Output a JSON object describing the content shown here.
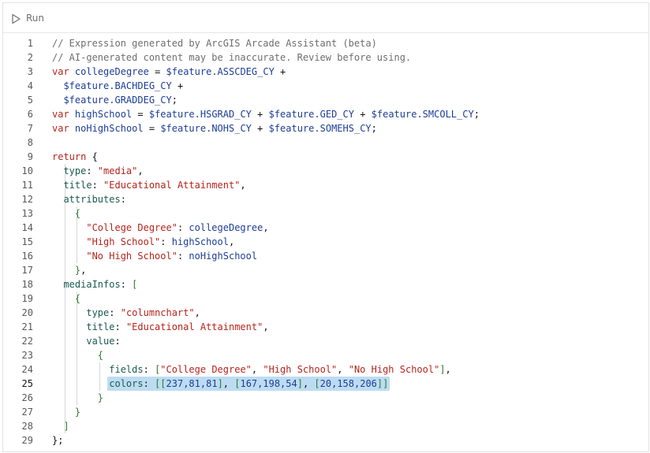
{
  "toolbar": {
    "run_label": "Run",
    "run_icon": "play-icon"
  },
  "editor": {
    "active_line": 25,
    "colors": {
      "comment": "#6e6e6e",
      "keyword": "#b6241c",
      "string": "#b6241c",
      "variable": "#1d3d97",
      "property": "#1a5b4d",
      "selection": "#bddcf2"
    },
    "lines": [
      {
        "n": "1",
        "tokens": [
          [
            "c",
            "// Expression generated by ArcGIS Arcade Assistant (beta)"
          ]
        ]
      },
      {
        "n": "2",
        "tokens": [
          [
            "c",
            "// AI-generated content may be inaccurate. Review before using."
          ]
        ]
      },
      {
        "n": "3",
        "tokens": [
          [
            "k",
            "var"
          ],
          [
            "p",
            " "
          ],
          [
            "v",
            "collegeDegree"
          ],
          [
            "p",
            " = "
          ],
          [
            "v",
            "$feature.ASSCDEG_CY"
          ],
          [
            "p",
            " +"
          ]
        ]
      },
      {
        "n": "4",
        "tokens": [
          [
            "p",
            "  "
          ],
          [
            "v",
            "$feature.BACHDEG_CY"
          ],
          [
            "p",
            " +"
          ]
        ]
      },
      {
        "n": "5",
        "tokens": [
          [
            "p",
            "  "
          ],
          [
            "v",
            "$feature.GRADDEG_CY"
          ],
          [
            "p",
            ";"
          ]
        ]
      },
      {
        "n": "6",
        "tokens": [
          [
            "k",
            "var"
          ],
          [
            "p",
            " "
          ],
          [
            "v",
            "highSchool"
          ],
          [
            "p",
            " = "
          ],
          [
            "v",
            "$feature.HSGRAD_CY"
          ],
          [
            "p",
            " + "
          ],
          [
            "v",
            "$feature.GED_CY"
          ],
          [
            "p",
            " + "
          ],
          [
            "v",
            "$feature.SMCOLL_CY"
          ],
          [
            "p",
            ";"
          ]
        ]
      },
      {
        "n": "7",
        "tokens": [
          [
            "k",
            "var"
          ],
          [
            "p",
            " "
          ],
          [
            "v",
            "noHighSchool"
          ],
          [
            "p",
            " = "
          ],
          [
            "v",
            "$feature.NOHS_CY"
          ],
          [
            "p",
            " + "
          ],
          [
            "v",
            "$feature.SOMEHS_CY"
          ],
          [
            "p",
            ";"
          ]
        ]
      },
      {
        "n": "8",
        "tokens": []
      },
      {
        "n": "9",
        "tokens": [
          [
            "k",
            "return"
          ],
          [
            "p",
            " {"
          ]
        ]
      },
      {
        "n": "10",
        "tokens": [
          [
            "p",
            "  "
          ],
          [
            "a",
            "type"
          ],
          [
            "p",
            ": "
          ],
          [
            "s",
            "\"media\""
          ],
          [
            "p",
            ","
          ]
        ]
      },
      {
        "n": "11",
        "tokens": [
          [
            "p",
            "  "
          ],
          [
            "a",
            "title"
          ],
          [
            "p",
            ": "
          ],
          [
            "s",
            "\"Educational Attainment\""
          ],
          [
            "p",
            ","
          ]
        ]
      },
      {
        "n": "12",
        "tokens": [
          [
            "p",
            "  "
          ],
          [
            "a",
            "attributes"
          ],
          [
            "p",
            ":"
          ]
        ]
      },
      {
        "n": "13",
        "tokens": [
          [
            "p",
            "    "
          ],
          [
            "b",
            "{"
          ]
        ]
      },
      {
        "n": "14",
        "tokens": [
          [
            "p",
            "      "
          ],
          [
            "s",
            "\"College Degree\""
          ],
          [
            "p",
            ": "
          ],
          [
            "v",
            "collegeDegree"
          ],
          [
            "p",
            ","
          ]
        ]
      },
      {
        "n": "15",
        "tokens": [
          [
            "p",
            "      "
          ],
          [
            "s",
            "\"High School\""
          ],
          [
            "p",
            ": "
          ],
          [
            "v",
            "highSchool"
          ],
          [
            "p",
            ","
          ]
        ]
      },
      {
        "n": "16",
        "tokens": [
          [
            "p",
            "      "
          ],
          [
            "s",
            "\"No High School\""
          ],
          [
            "p",
            ": "
          ],
          [
            "v",
            "noHighSchool"
          ]
        ]
      },
      {
        "n": "17",
        "tokens": [
          [
            "p",
            "    "
          ],
          [
            "b",
            "}"
          ],
          [
            "p",
            ","
          ]
        ]
      },
      {
        "n": "18",
        "tokens": [
          [
            "p",
            "  "
          ],
          [
            "a",
            "mediaInfos"
          ],
          [
            "p",
            ": "
          ],
          [
            "b",
            "["
          ]
        ]
      },
      {
        "n": "19",
        "tokens": [
          [
            "p",
            "    "
          ],
          [
            "b",
            "{"
          ]
        ]
      },
      {
        "n": "20",
        "tokens": [
          [
            "p",
            "      "
          ],
          [
            "a",
            "type"
          ],
          [
            "p",
            ": "
          ],
          [
            "s",
            "\"columnchart\""
          ],
          [
            "p",
            ","
          ]
        ]
      },
      {
        "n": "21",
        "tokens": [
          [
            "p",
            "      "
          ],
          [
            "a",
            "title"
          ],
          [
            "p",
            ": "
          ],
          [
            "s",
            "\"Educational Attainment\""
          ],
          [
            "p",
            ","
          ]
        ]
      },
      {
        "n": "22",
        "tokens": [
          [
            "p",
            "      "
          ],
          [
            "a",
            "value"
          ],
          [
            "p",
            ":"
          ]
        ]
      },
      {
        "n": "23",
        "tokens": [
          [
            "p",
            "        "
          ],
          [
            "b",
            "{"
          ]
        ]
      },
      {
        "n": "24",
        "tokens": [
          [
            "p",
            "          "
          ],
          [
            "a",
            "fields"
          ],
          [
            "p",
            ": "
          ],
          [
            "b",
            "["
          ],
          [
            "s",
            "\"College Degree\""
          ],
          [
            "p",
            ", "
          ],
          [
            "s",
            "\"High School\""
          ],
          [
            "p",
            ", "
          ],
          [
            "s",
            "\"No High School\""
          ],
          [
            "b",
            "]"
          ],
          [
            "p",
            ","
          ]
        ]
      },
      {
        "n": "25",
        "tokens": [
          [
            "p",
            "          "
          ],
          [
            "a",
            "colors"
          ],
          [
            "p",
            ": "
          ],
          [
            "b",
            "["
          ],
          [
            "b",
            "["
          ],
          [
            "n",
            "237,81,81"
          ],
          [
            "b",
            "]"
          ],
          [
            "p",
            ", "
          ],
          [
            "b",
            "["
          ],
          [
            "n",
            "167,198,54"
          ],
          [
            "b",
            "]"
          ],
          [
            "p",
            ", "
          ],
          [
            "b",
            "["
          ],
          [
            "n",
            "20,158,206"
          ],
          [
            "b",
            "]"
          ],
          [
            "b",
            "]"
          ]
        ]
      },
      {
        "n": "26",
        "tokens": [
          [
            "p",
            "        "
          ],
          [
            "b",
            "}"
          ]
        ]
      },
      {
        "n": "27",
        "tokens": [
          [
            "p",
            "    "
          ],
          [
            "b",
            "}"
          ]
        ]
      },
      {
        "n": "28",
        "tokens": [
          [
            "p",
            "  "
          ],
          [
            "b",
            "]"
          ]
        ]
      },
      {
        "n": "29",
        "tokens": [
          [
            "p",
            "};"
          ]
        ]
      }
    ]
  }
}
